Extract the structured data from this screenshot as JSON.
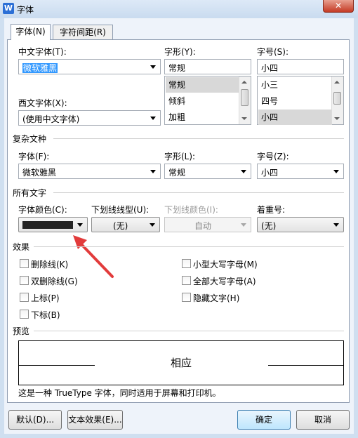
{
  "window": {
    "title": "字体",
    "app_icon_glyph": "W",
    "close_glyph": "✕"
  },
  "tabs": [
    {
      "label": "字体(N)",
      "key": "N"
    },
    {
      "label": "字符间距(R)",
      "key": "R"
    }
  ],
  "chinese_font": {
    "label": "中文字体(T):",
    "value": "微软雅黑"
  },
  "style": {
    "label": "字形(Y):",
    "value": "常规",
    "options": [
      "常规",
      "倾斜",
      "加粗"
    ]
  },
  "size": {
    "label": "字号(S):",
    "value": "小四",
    "options": [
      "小三",
      "四号",
      "小四"
    ]
  },
  "western_font": {
    "label": "西文字体(X):",
    "value": "(使用中文字体)"
  },
  "complex": {
    "section": "复杂文种",
    "font_label": "字体(F):",
    "font_value": "微软雅黑",
    "style_label": "字形(L):",
    "style_value": "常规",
    "size_label": "字号(Z):",
    "size_value": "小四"
  },
  "all_text": {
    "section": "所有文字",
    "color_label": "字体颜色(C):",
    "color_swatch": "#222222",
    "underline_label": "下划线线型(U):",
    "underline_value": "(无)",
    "underline_color_label": "下划线颜色(I):",
    "underline_color_value": "自动",
    "emphasis_label": "着重号:",
    "emphasis_value": "(无)"
  },
  "effects": {
    "section": "效果",
    "left": [
      "删除线(K)",
      "双删除线(G)",
      "上标(P)",
      "下标(B)"
    ],
    "right": [
      "小型大写字母(M)",
      "全部大写字母(A)",
      "隐藏文字(H)"
    ]
  },
  "preview": {
    "section": "预览",
    "sample": "相应",
    "note": "这是一种 TrueType 字体，同时适用于屏幕和打印机。"
  },
  "buttons": {
    "default": "默认(D)...",
    "text_effects": "文本效果(E)...",
    "ok": "确定",
    "cancel": "取消"
  },
  "colors": {
    "annotation_arrow": "#e23b3b",
    "selection": "#3399ff"
  }
}
